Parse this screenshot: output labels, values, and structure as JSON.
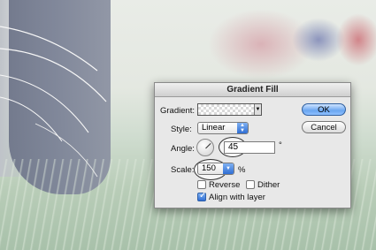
{
  "dialog": {
    "title": "Gradient Fill",
    "gradient_label": "Gradient:",
    "gradient_arrow_icon": "dropdown-arrow-icon",
    "style_label": "Style:",
    "style_value": "Linear",
    "angle_label": "Angle:",
    "angle_value": "45",
    "angle_unit": "°",
    "scale_label": "Scale:",
    "scale_value": "150",
    "scale_unit": "%",
    "reverse_label": "Reverse",
    "reverse_checked": false,
    "dither_label": "Dither",
    "dither_checked": false,
    "align_label": "Align with layer",
    "align_checked": true,
    "ok_label": "OK",
    "cancel_label": "Cancel"
  },
  "colors": {
    "default_button": "#6aa6f0",
    "dialog_bg": "#e8e8e8"
  }
}
